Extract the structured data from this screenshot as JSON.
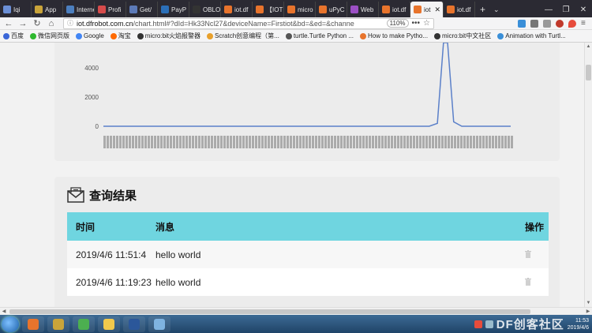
{
  "tabs": [
    {
      "label": "Iqi",
      "color": "#6b8fd6"
    },
    {
      "label": "App",
      "color": "#c9a43a"
    },
    {
      "label": "Internet",
      "color": "#4c7fbf"
    },
    {
      "label": "Profi",
      "color": "#d64b4b"
    },
    {
      "label": "Get/",
      "color": "#5c7ab8"
    },
    {
      "label": "PayP",
      "color": "#2b6fb8"
    },
    {
      "label": "OBLO",
      "color": "#333333"
    },
    {
      "label": "iot.df",
      "color": "#e8742c"
    },
    {
      "label": "【IOT",
      "color": "#e8742c"
    },
    {
      "label": "micro",
      "color": "#e8742c"
    },
    {
      "label": "uPyC",
      "color": "#e8742c"
    },
    {
      "label": "Web",
      "color": "#9b4fc4"
    },
    {
      "label": "iot.df",
      "color": "#e8742c"
    },
    {
      "label": "iot",
      "color": "#e8742c",
      "active": true
    },
    {
      "label": "iot.df",
      "color": "#e8742c"
    }
  ],
  "new_tab_label": "+",
  "url": {
    "host": "iot.dfrobot.com.cn",
    "path": "/chart.html#?dId=Hk33Ncl27&deviceName=Firstiot&bd=&ed=&channe",
    "zoom": "110%",
    "more": "•••",
    "star": "☆"
  },
  "bookmarks": [
    {
      "label": "百度",
      "color": "#3a66d8"
    },
    {
      "label": "微信网页版",
      "color": "#2eb82e"
    },
    {
      "label": "Google",
      "color": "#4285f4"
    },
    {
      "label": "淘宝",
      "color": "#ff6a00"
    },
    {
      "label": "micro:bit火焰报警器",
      "color": "#333333"
    },
    {
      "label": "Scratch创意编程（第...",
      "color": "#e8a02c"
    },
    {
      "label": "turtle.Turtle Python ...",
      "color": "#555555"
    },
    {
      "label": "How to make Pytho...",
      "color": "#e8742c"
    },
    {
      "label": "micro:bit中文社区",
      "color": "#333333"
    },
    {
      "label": "Animation with Turtl...",
      "color": "#3a8fd8"
    }
  ],
  "chart_data": {
    "type": "line",
    "ylim": [
      0,
      5000
    ],
    "y_ticks": [
      "0",
      "2000",
      "4000"
    ],
    "points": [
      {
        "t": 0,
        "v": 0
      },
      {
        "t": 0.8,
        "v": 0
      },
      {
        "t": 0.82,
        "v": 200
      },
      {
        "t": 0.835,
        "v": 6000
      },
      {
        "t": 0.845,
        "v": 6000
      },
      {
        "t": 0.86,
        "v": 300
      },
      {
        "t": 0.88,
        "v": 0
      },
      {
        "t": 1.0,
        "v": 0
      }
    ],
    "line_color": "#5b80c9",
    "x_tick_labels_note": ""
  },
  "results": {
    "title": "查询结果",
    "columns": {
      "time": "时间",
      "message": "消息",
      "actions": "操作"
    },
    "rows": [
      {
        "time": "2019/4/6 11:51:4",
        "message": "hello world"
      },
      {
        "time": "2019/4/6 11:19:23",
        "message": "hello world"
      }
    ]
  },
  "taskbar": {
    "apps": [
      {
        "name": "firefox",
        "color": "#e8742c"
      },
      {
        "name": "robot-app",
        "color": "#c9a43a"
      },
      {
        "name": "chrome",
        "color": "#4caf50"
      },
      {
        "name": "file-explorer",
        "color": "#f2c94c"
      },
      {
        "name": "word",
        "color": "#2b579a"
      },
      {
        "name": "paint",
        "color": "#7fb3e0"
      }
    ],
    "watermark": "DF创客社区",
    "time": "11:53",
    "date": "2019/4/6"
  }
}
